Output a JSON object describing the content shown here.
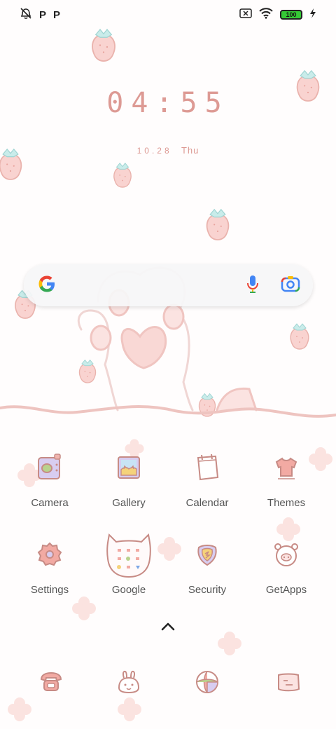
{
  "status_bar": {
    "left_icons": [
      "alarm-off-icon",
      "p-icon",
      "p-icon"
    ],
    "p_letter": "P",
    "right_icons": [
      "no-sim-icon",
      "wifi-icon",
      "battery-icon",
      "charging-icon"
    ],
    "battery_level": "100"
  },
  "lock": {
    "time": "04:55",
    "date": "10.28",
    "day": "Thu"
  },
  "search": {
    "icons": [
      "google-g-icon",
      "microphone-icon",
      "lens-camera-icon"
    ]
  },
  "apps": [
    {
      "label": "Camera",
      "icon": "camera-icon"
    },
    {
      "label": "Gallery",
      "icon": "gallery-icon"
    },
    {
      "label": "Calendar",
      "icon": "calendar-icon"
    },
    {
      "label": "Themes",
      "icon": "themes-icon"
    },
    {
      "label": "Settings",
      "icon": "settings-gear-icon"
    },
    {
      "label": "Google",
      "icon": "google-folder-icon"
    },
    {
      "label": "Security",
      "icon": "security-shield-icon"
    },
    {
      "label": "GetApps",
      "icon": "getapps-icon"
    }
  ],
  "dock": [
    {
      "icon": "phone-icon"
    },
    {
      "icon": "messages-bunny-icon"
    },
    {
      "icon": "browser-ball-icon"
    },
    {
      "icon": "notes-icon"
    }
  ],
  "colors": {
    "accent_pink": "#dd9a94",
    "strawberry": "#f4b8b4",
    "leaf": "#bfe6e4"
  }
}
